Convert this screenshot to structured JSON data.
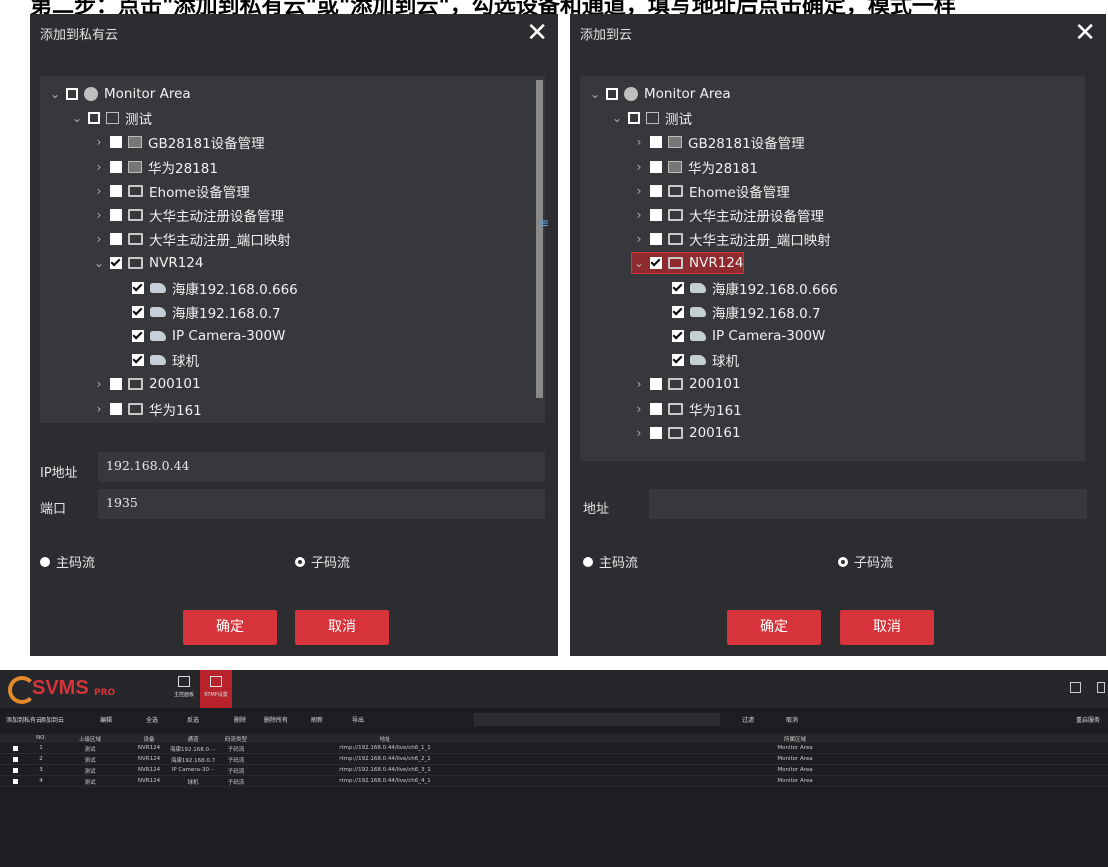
{
  "banner_text": "第二步：点击\"添加到私有云\"或\"添加到云\"，勾选设备和通道，填写地址后点击确定，模式一样",
  "left_dialog": {
    "title": "添加到私有云",
    "close": "✕",
    "tree": [
      {
        "label": "Monitor Area",
        "level": 0,
        "chevron": "⌄",
        "cb": "outline",
        "icon": "globe-icon"
      },
      {
        "label": "测试",
        "level": 1,
        "chevron": "⌄",
        "cb": "outline",
        "icon": "org-icon"
      },
      {
        "label": "GB28181设备管理",
        "level": 2,
        "chevron": "›",
        "cb": "empty",
        "icon": "device-icon"
      },
      {
        "label": "华为28181",
        "level": 2,
        "chevron": "›",
        "cb": "empty",
        "icon": "device-icon"
      },
      {
        "label": "Ehome设备管理",
        "level": 2,
        "chevron": "›",
        "cb": "empty",
        "icon": "monitor-icon"
      },
      {
        "label": "大华主动注册设备管理",
        "level": 2,
        "chevron": "›",
        "cb": "empty",
        "icon": "monitor-icon"
      },
      {
        "label": "大华主动注册_端口映射",
        "level": 2,
        "chevron": "›",
        "cb": "empty",
        "icon": "monitor-icon"
      },
      {
        "label": "NVR124",
        "level": 2,
        "chevron": "⌄",
        "cb": "checked",
        "icon": "monitor-icon"
      },
      {
        "label": "海康192.168.0.666",
        "level": 3,
        "chevron": "",
        "cb": "checked",
        "icon": "camera-icon"
      },
      {
        "label": "海康192.168.0.7",
        "level": 3,
        "chevron": "",
        "cb": "checked",
        "icon": "camera-icon"
      },
      {
        "label": "IP Camera-300W",
        "level": 3,
        "chevron": "",
        "cb": "checked",
        "icon": "camera-icon"
      },
      {
        "label": "球机",
        "level": 3,
        "chevron": "",
        "cb": "checked",
        "icon": "camera-icon"
      },
      {
        "label": "200101",
        "level": 2,
        "chevron": "›",
        "cb": "empty",
        "icon": "monitor-icon"
      },
      {
        "label": "华为161",
        "level": 2,
        "chevron": "›",
        "cb": "empty",
        "icon": "monitor-icon"
      }
    ],
    "ip_label": "IP地址",
    "ip_value": "192.168.0.44",
    "port_label": "端口",
    "port_value": "1935",
    "radio_main": "主码流",
    "radio_sub": "子码流",
    "ok": "确定",
    "cancel": "取消"
  },
  "right_dialog": {
    "title": "添加到云",
    "close": "✕",
    "tree": [
      {
        "label": "Monitor Area",
        "level": 0,
        "chevron": "⌄",
        "cb": "outline",
        "icon": "globe-icon"
      },
      {
        "label": "测试",
        "level": 1,
        "chevron": "⌄",
        "cb": "outline",
        "icon": "org-icon"
      },
      {
        "label": "GB28181设备管理",
        "level": 2,
        "chevron": "›",
        "cb": "empty",
        "icon": "device-icon"
      },
      {
        "label": "华为28181",
        "level": 2,
        "chevron": "›",
        "cb": "empty",
        "icon": "device-icon"
      },
      {
        "label": "Ehome设备管理",
        "level": 2,
        "chevron": "›",
        "cb": "empty",
        "icon": "monitor-icon"
      },
      {
        "label": "大华主动注册设备管理",
        "level": 2,
        "chevron": "›",
        "cb": "empty",
        "icon": "monitor-icon"
      },
      {
        "label": "大华主动注册_端口映射",
        "level": 2,
        "chevron": "›",
        "cb": "empty",
        "icon": "monitor-icon"
      },
      {
        "label": "NVR124",
        "level": 2,
        "chevron": "⌄",
        "cb": "checked",
        "icon": "monitor-icon",
        "selected": true
      },
      {
        "label": "海康192.168.0.666",
        "level": 3,
        "chevron": "",
        "cb": "checked",
        "icon": "camera-icon"
      },
      {
        "label": "海康192.168.0.7",
        "level": 3,
        "chevron": "",
        "cb": "checked",
        "icon": "camera-icon"
      },
      {
        "label": "IP Camera-300W",
        "level": 3,
        "chevron": "",
        "cb": "checked",
        "icon": "camera-icon"
      },
      {
        "label": "球机",
        "level": 3,
        "chevron": "",
        "cb": "checked",
        "icon": "camera-icon"
      },
      {
        "label": "200101",
        "level": 2,
        "chevron": "›",
        "cb": "empty",
        "icon": "monitor-icon"
      },
      {
        "label": "华为161",
        "level": 2,
        "chevron": "›",
        "cb": "empty",
        "icon": "monitor-icon"
      },
      {
        "label": "200161",
        "level": 2,
        "chevron": "›",
        "cb": "empty",
        "icon": "monitor-icon"
      }
    ],
    "addr_label": "地址",
    "addr_value": "",
    "radio_main": "主码流",
    "radio_sub": "子码流",
    "ok": "确定",
    "cancel": "取消"
  },
  "app": {
    "logo_text": "SVMS",
    "logo_sub": "PRO",
    "nav_tabs": [
      {
        "label": "主控面板",
        "active": false
      },
      {
        "label": "RTMP设置",
        "active": true
      }
    ],
    "toolbar": [
      "添加到私有云",
      "添加到云",
      "编辑",
      "全选",
      "反选",
      "删除",
      "删除所有",
      "刷新",
      "导出",
      "过滤",
      "取消",
      "重启服务"
    ],
    "columns": [
      "NO.",
      "上级区域",
      "设备",
      "通道",
      "码流类型",
      "地址",
      "所属区域"
    ],
    "rows": [
      [
        "1",
        "测试",
        "NVR124",
        "海康192.168.0.···",
        "子码流",
        "rtmp://192.168.0.44/live/ch6_1_1",
        "Monitor Area"
      ],
      [
        "2",
        "测试",
        "NVR124",
        "海康192.168.0.7",
        "子码流",
        "rtmp://192.168.0.44/live/ch6_2_1",
        "Monitor Area"
      ],
      [
        "3",
        "测试",
        "NVR124",
        "IP Camera-30···",
        "子码流",
        "rtmp://192.168.0.44/live/ch6_3_1",
        "Monitor Area"
      ],
      [
        "4",
        "测试",
        "NVR124",
        "球机",
        "子码流",
        "rtmp://192.168.0.44/live/ch6_4_1",
        "Monitor Area"
      ]
    ]
  }
}
